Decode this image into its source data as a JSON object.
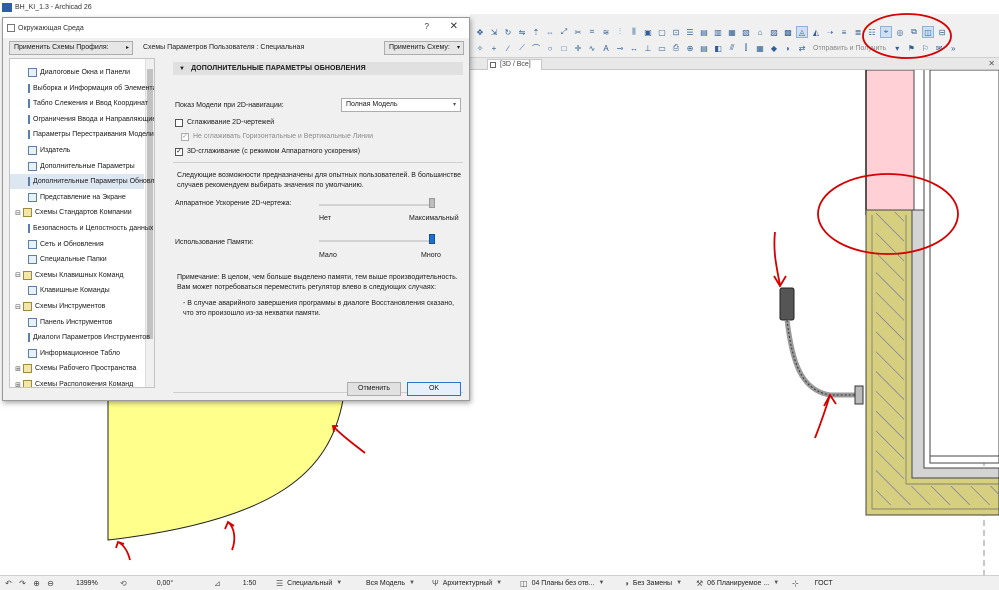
{
  "app": {
    "title": "BH_KI_1.3 - Archicad 26"
  },
  "view_tab": {
    "label": "[3D / Все]"
  },
  "toolbar": {
    "send_button_label": "Отправить и Получить"
  },
  "dialog": {
    "title": "Окружающая Среда",
    "help_glyph": "?",
    "close_glyph": "✕",
    "apply_profile_label": "Применить Схемы Профиля:",
    "scheme_label": "Схемы Параметров Пользователя : Специальная",
    "apply_scheme_label": "Применить Схему:",
    "tree": [
      {
        "label": "Диалоговые Окна и Панели",
        "level": 1,
        "expander": ""
      },
      {
        "label": "Выборка и Информация об Элементах",
        "level": 1,
        "expander": ""
      },
      {
        "label": "Табло Слежения и Ввод Координат",
        "level": 1,
        "expander": ""
      },
      {
        "label": "Ограничения Ввода и Направляющие",
        "level": 1,
        "expander": ""
      },
      {
        "label": "Параметры Перестраивания Модели",
        "level": 1,
        "expander": ""
      },
      {
        "label": "Издатель",
        "level": 1,
        "expander": ""
      },
      {
        "label": "Дополнительные Параметры",
        "level": 1,
        "expander": ""
      },
      {
        "label": "Дополнительные Параметры Обновления",
        "level": 1,
        "expander": "",
        "selected": true
      },
      {
        "label": "Представление на Экране",
        "level": 1,
        "expander": ""
      },
      {
        "label": "Схемы Стандартов Компании",
        "level": 0,
        "expander": "⊟"
      },
      {
        "label": "Безопасность и Целостность данных",
        "level": 1,
        "expander": ""
      },
      {
        "label": "Сеть и Обновления",
        "level": 1,
        "expander": ""
      },
      {
        "label": "Специальные Папки",
        "level": 1,
        "expander": ""
      },
      {
        "label": "Схемы Клавишных Команд",
        "level": 0,
        "expander": "⊟"
      },
      {
        "label": "Клавишные Команды",
        "level": 1,
        "expander": ""
      },
      {
        "label": "Схемы Инструментов",
        "level": 0,
        "expander": "⊟"
      },
      {
        "label": "Панель Инструментов",
        "level": 1,
        "expander": ""
      },
      {
        "label": "Диалоги Параметров Инструментов",
        "level": 1,
        "expander": ""
      },
      {
        "label": "Информационное Табло",
        "level": 1,
        "expander": ""
      },
      {
        "label": "Схемы Рабочего Пространства",
        "level": 0,
        "expander": "⊞"
      },
      {
        "label": "Схемы Расположения Команд",
        "level": 0,
        "expander": "⊞"
      }
    ],
    "section_title": "ДОПОЛНИТЕЛЬНЫЕ ПАРАМЕТРЫ ОБНОВЛЕНИЯ",
    "nav_display_label": "Показ Модели при 2D-навигации:",
    "nav_display_value": "Полная Модель",
    "smooth_2d_label": "Сглаживание 2D-чертежей",
    "smooth_2d_checked": false,
    "no_smooth_hv_label": "Не сглаживать Горизонтальные и Вертикальные Линии",
    "no_smooth_hv_checked": true,
    "smooth_3d_label": "3D-сглаживание (с режимом Аппаратного ускорения)",
    "smooth_3d_checked": true,
    "check_mark": "✓",
    "expert_note": "Следующие возможности предназначены для опытных пользователей. В большинстве случаев рекомендуем выбирать значения по умолчанию.",
    "hw_accel_label": "Аппаратное Ускорение 2D-чертежа:",
    "hw_accel_min": "Нет",
    "hw_accel_max": "Максимальный",
    "hw_accel_level": 1.0,
    "memory_label": "Использование Памяти:",
    "memory_min": "Мало",
    "memory_max": "Много",
    "memory_level": 1.0,
    "memory_note": "Примечание: В целом, чем больше выделено памяти, тем выше производительность. Вам может потребоваться переместить регулятор влево в следующих случаях:",
    "memory_case": "- В случае аварийного завершения программы в диалоге Восстановления сказано, что это произошло из-за нехватки памяти.",
    "cancel_label": "Отменить",
    "ok_label": "OK"
  },
  "statusbar": {
    "zoom": "1399%",
    "angle": "0,00°",
    "scale": "1:50",
    "layer_combo": "Специальный",
    "model_view": "Вся Модель",
    "pen_set": "Архитектурный",
    "plan_view": "04 Планы без отв...",
    "override": "Без Замены",
    "renovation": "06 Планируемое ...",
    "standard": "ГОСТ"
  },
  "colors": {
    "annotation_red": "#d40000",
    "yellow_fill": "#ffff8c",
    "pink_fill": "#ffd1d6",
    "insulation": "#d6cf7f",
    "gray_zone": "#d4d4d4",
    "accent": "#1e6fd0"
  }
}
